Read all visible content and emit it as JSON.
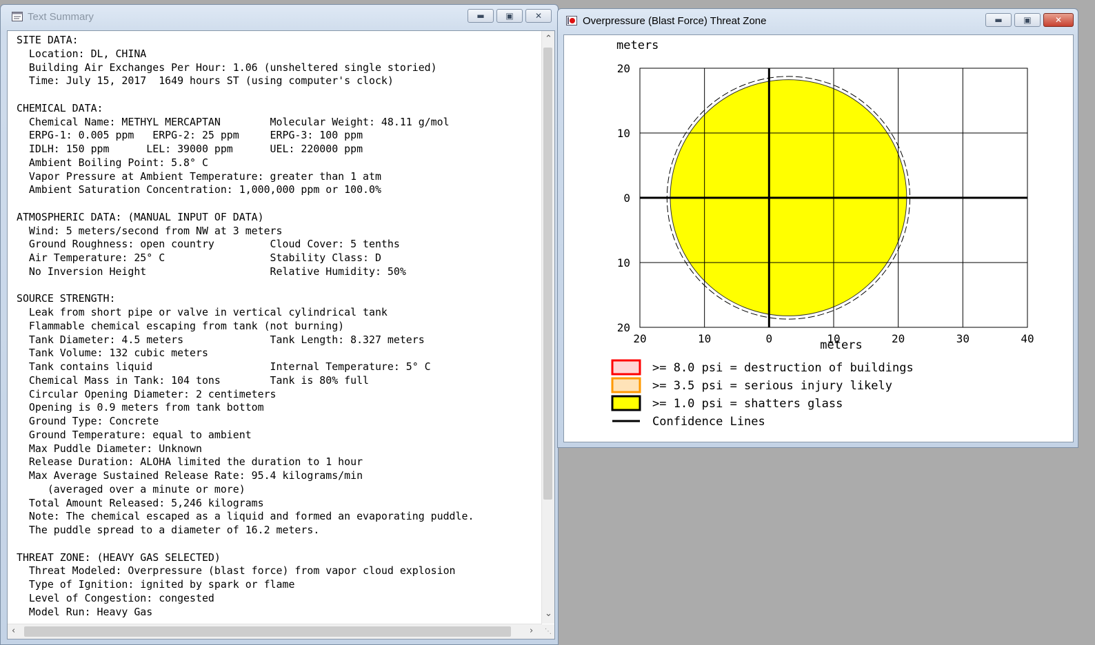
{
  "text_window": {
    "title": "Text Summary",
    "lines": [
      "SITE DATA:",
      "  Location: DL, CHINA",
      "  Building Air Exchanges Per Hour: 1.06 (unsheltered single storied)",
      "  Time: July 15, 2017  1649 hours ST (using computer's clock)",
      "",
      "CHEMICAL DATA:",
      "  Chemical Name: METHYL MERCAPTAN        Molecular Weight: 48.11 g/mol",
      "  ERPG-1: 0.005 ppm   ERPG-2: 25 ppm     ERPG-3: 100 ppm",
      "  IDLH: 150 ppm      LEL: 39000 ppm      UEL: 220000 ppm",
      "  Ambient Boiling Point: 5.8° C",
      "  Vapor Pressure at Ambient Temperature: greater than 1 atm",
      "  Ambient Saturation Concentration: 1,000,000 ppm or 100.0%",
      "",
      "ATMOSPHERIC DATA: (MANUAL INPUT OF DATA)",
      "  Wind: 5 meters/second from NW at 3 meters",
      "  Ground Roughness: open country         Cloud Cover: 5 tenths",
      "  Air Temperature: 25° C                 Stability Class: D",
      "  No Inversion Height                    Relative Humidity: 50%",
      "",
      "SOURCE STRENGTH:",
      "  Leak from short pipe or valve in vertical cylindrical tank",
      "  Flammable chemical escaping from tank (not burning)",
      "  Tank Diameter: 4.5 meters              Tank Length: 8.327 meters",
      "  Tank Volume: 132 cubic meters",
      "  Tank contains liquid                   Internal Temperature: 5° C",
      "  Chemical Mass in Tank: 104 tons        Tank is 80% full",
      "  Circular Opening Diameter: 2 centimeters",
      "  Opening is 0.9 meters from tank bottom",
      "  Ground Type: Concrete",
      "  Ground Temperature: equal to ambient",
      "  Max Puddle Diameter: Unknown",
      "  Release Duration: ALOHA limited the duration to 1 hour",
      "  Max Average Sustained Release Rate: 95.4 kilograms/min",
      "     (averaged over a minute or more)",
      "  Total Amount Released: 5,246 kilograms",
      "  Note: The chemical escaped as a liquid and formed an evaporating puddle.",
      "  The puddle spread to a diameter of 16.2 meters.",
      "",
      "THREAT ZONE: (HEAVY GAS SELECTED)",
      "  Threat Modeled: Overpressure (blast force) from vapor cloud explosion",
      "  Type of Ignition: ignited by spark or flame",
      "  Level of Congestion: congested",
      "  Model Run: Heavy Gas"
    ]
  },
  "plot_window": {
    "title": "Overpressure (Blast Force) Threat Zone"
  },
  "chart_data": {
    "type": "threat-zone-plot",
    "y_axis_label": "meters",
    "x_axis_label": "meters",
    "x_ticks": [
      -20,
      -10,
      0,
      10,
      20,
      30,
      40
    ],
    "x_tick_labels": [
      "20",
      "10",
      "0",
      "10",
      "20",
      "30",
      "40"
    ],
    "y_ticks": [
      20,
      10,
      0,
      -10,
      -20
    ],
    "y_tick_labels": [
      "20",
      "10",
      "0",
      "10",
      "20"
    ],
    "xlim": [
      -20,
      40
    ],
    "ylim": [
      -20,
      20
    ],
    "grid": true,
    "zones": [
      {
        "label": ">= 8.0 psi = destruction of buildings",
        "color": "#ff0000",
        "swatch_fill": "#ffd6d6",
        "extent": null
      },
      {
        "label": ">= 3.5 psi = serious injury likely",
        "color": "#ff9900",
        "swatch_fill": "#ffe3b8",
        "extent": null
      },
      {
        "label": ">= 1.0 psi = shatters glass",
        "color": "#ffff00",
        "swatch_fill": "#ffff00",
        "center": [
          3,
          0
        ],
        "radius": 18.3
      }
    ],
    "confidence_lines": {
      "label": "Confidence Lines",
      "center": [
        3,
        0
      ],
      "radius": 18.8
    },
    "legend_position": "bottom"
  }
}
